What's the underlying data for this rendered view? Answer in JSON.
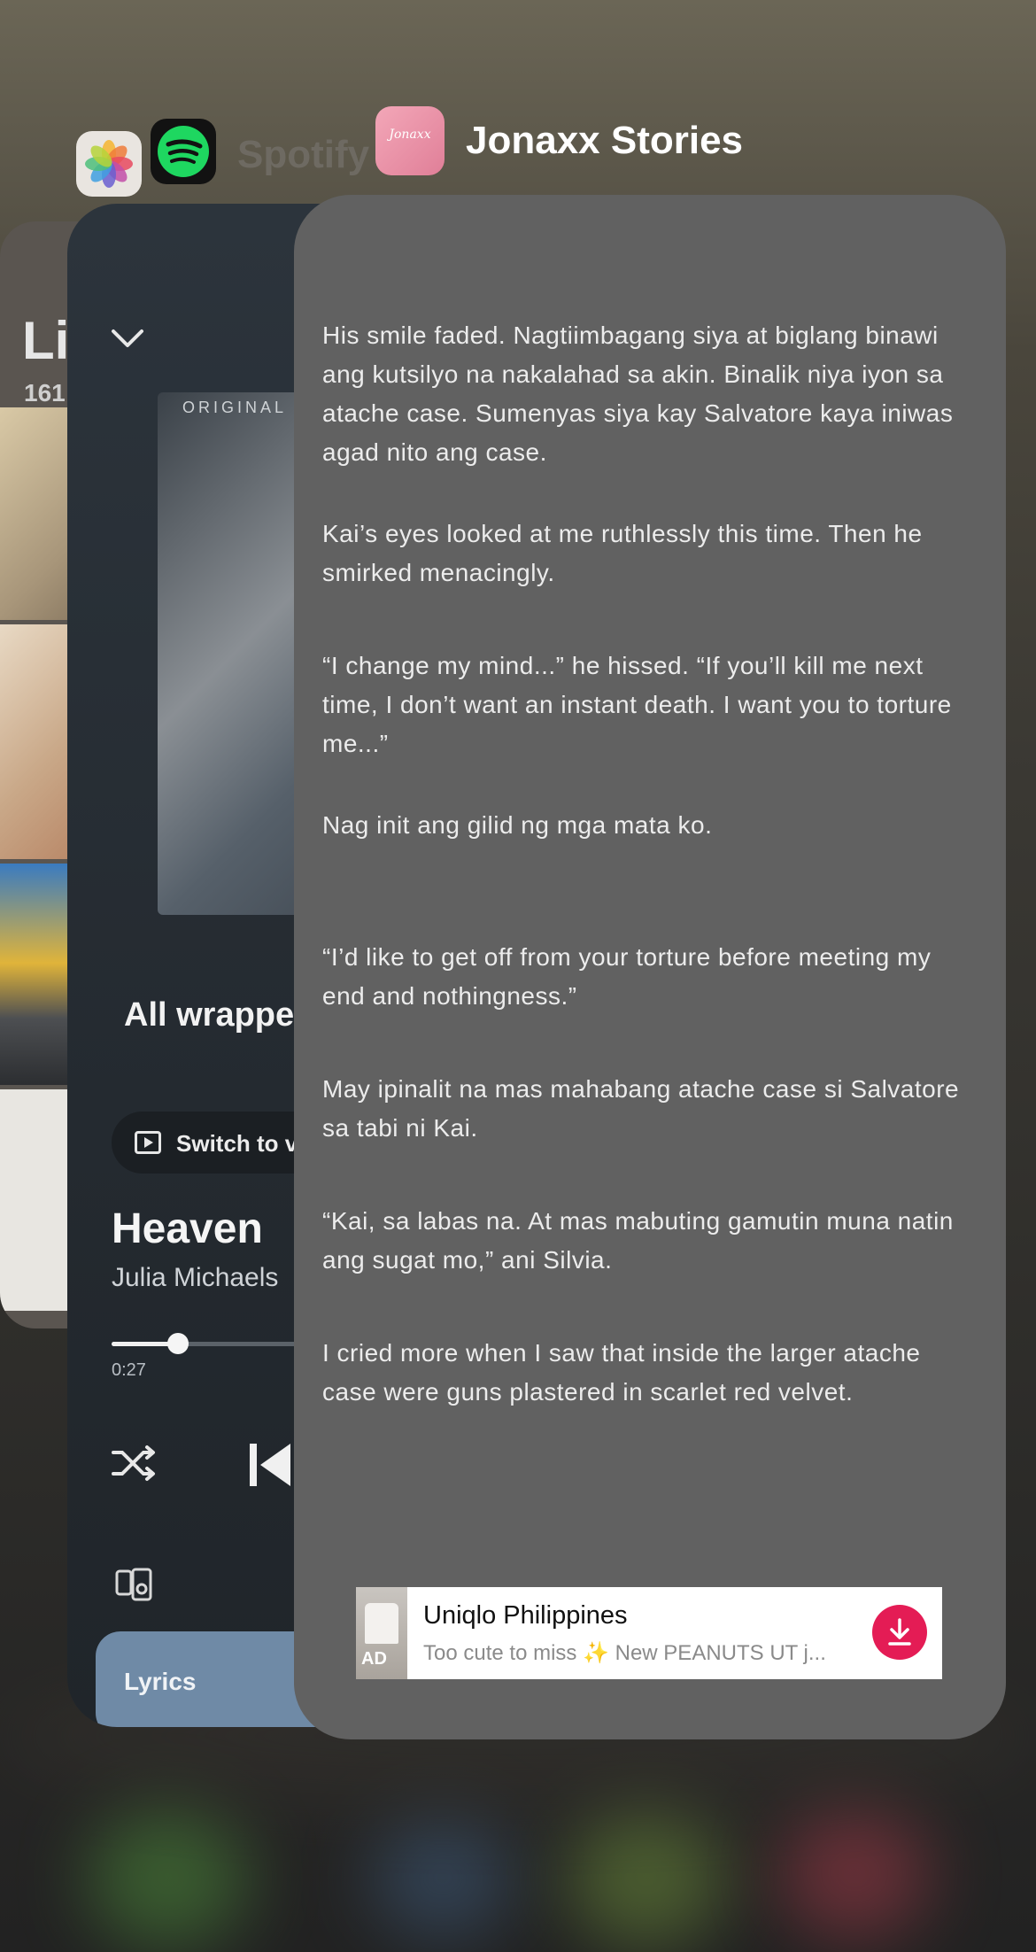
{
  "app_switcher": {
    "apps": [
      {
        "name": "Photos",
        "icon": "photos-icon"
      },
      {
        "name": "Spotify",
        "icon": "spotify-icon"
      },
      {
        "name": "Jonaxx Stories",
        "icon": "jonaxx-icon"
      }
    ],
    "spotify_label": "Spotify",
    "jonaxx_label": "Jonaxx Stories",
    "jonaxx_icon_text": "Jonaxx"
  },
  "photos_card": {
    "title": "Li",
    "count": "161"
  },
  "spotify_card": {
    "album_label": "ORIGINAL",
    "now_playing_title": "All wrappe",
    "switch_label": "Switch to v",
    "track_title": "Heaven",
    "track_artist": "Julia Michaels",
    "elapsed": "0:27",
    "progress_fraction": 0.15,
    "lyrics_label": "Lyrics",
    "accent_color": "#6f8aa6"
  },
  "jonaxx_card": {
    "paragraphs": [
      "His smile faded. Nagtiimbagang siya at biglang binawi ang kutsilyo na nakalahad sa akin. Binalik niya iyon sa atache case. Sumenyas siya kay Salvatore kaya iniwas agad nito ang case.",
      "Kai’s eyes looked at me ruthlessly this time. Then he smirked menacingly.",
      "“I change my mind...” he hissed. “If you’ll kill me next time, I don’t want an instant death. I want you to torture me...”",
      "Nag init ang gilid ng mga mata ko.",
      "“I’d like to get off from your torture before meeting my end and nothingness.”",
      "May ipinalit na mas mahabang atache case si Salvatore sa tabi ni Kai.",
      "“Kai, sa labas na. At mas mabuting gamutin muna natin ang sugat mo,” ani Silvia.",
      "I cried more when I saw that inside the larger atache case were guns plastered in scarlet red velvet."
    ],
    "ad": {
      "tag": "AD",
      "title": "Uniqlo Philippines",
      "subtitle": "Too cute to miss ✨ New PEANUTS UT j...",
      "button_color": "#e41c55",
      "button_icon": "download-icon"
    }
  }
}
